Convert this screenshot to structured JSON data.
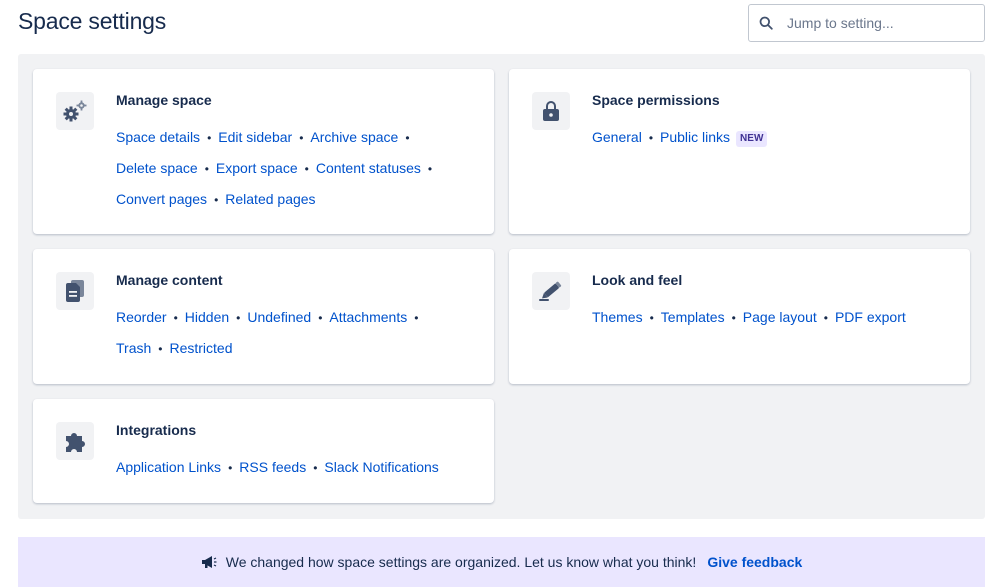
{
  "page": {
    "title": "Space settings"
  },
  "search": {
    "placeholder": "Jump to setting..."
  },
  "cards": {
    "manage_space": {
      "title": "Manage space",
      "icon": "gears-icon",
      "lines": [
        [
          "Space details",
          "Edit sidebar",
          "Archive space"
        ],
        [
          "Delete space",
          "Export space",
          "Content statuses"
        ],
        [
          "Convert pages",
          "Related pages"
        ]
      ]
    },
    "space_permissions": {
      "title": "Space permissions",
      "icon": "lock-icon",
      "lines": [
        [
          "General",
          "Public links"
        ]
      ],
      "badge": "NEW"
    },
    "manage_content": {
      "title": "Manage content",
      "icon": "documents-icon",
      "lines": [
        [
          "Reorder",
          "Hidden",
          "Undefined",
          "Attachments"
        ],
        [
          "Trash",
          "Restricted"
        ]
      ]
    },
    "look_and_feel": {
      "title": "Look and feel",
      "icon": "pencil-icon",
      "lines": [
        [
          "Themes",
          "Templates",
          "Page layout",
          "PDF export"
        ]
      ]
    },
    "integrations": {
      "title": "Integrations",
      "icon": "puzzle-icon",
      "lines": [
        [
          "Application Links",
          "RSS feeds",
          "Slack Notifications"
        ]
      ]
    }
  },
  "banner": {
    "icon": "megaphone-icon",
    "message": "We changed how space settings are organized. Let us know what you think!",
    "link": "Give feedback"
  },
  "colors": {
    "link": "#0052cc",
    "text": "#172b4d",
    "panel": "#f1f2f4",
    "banner": "#eae6ff",
    "badge_bg": "#eae6ff",
    "badge_text": "#403294"
  }
}
